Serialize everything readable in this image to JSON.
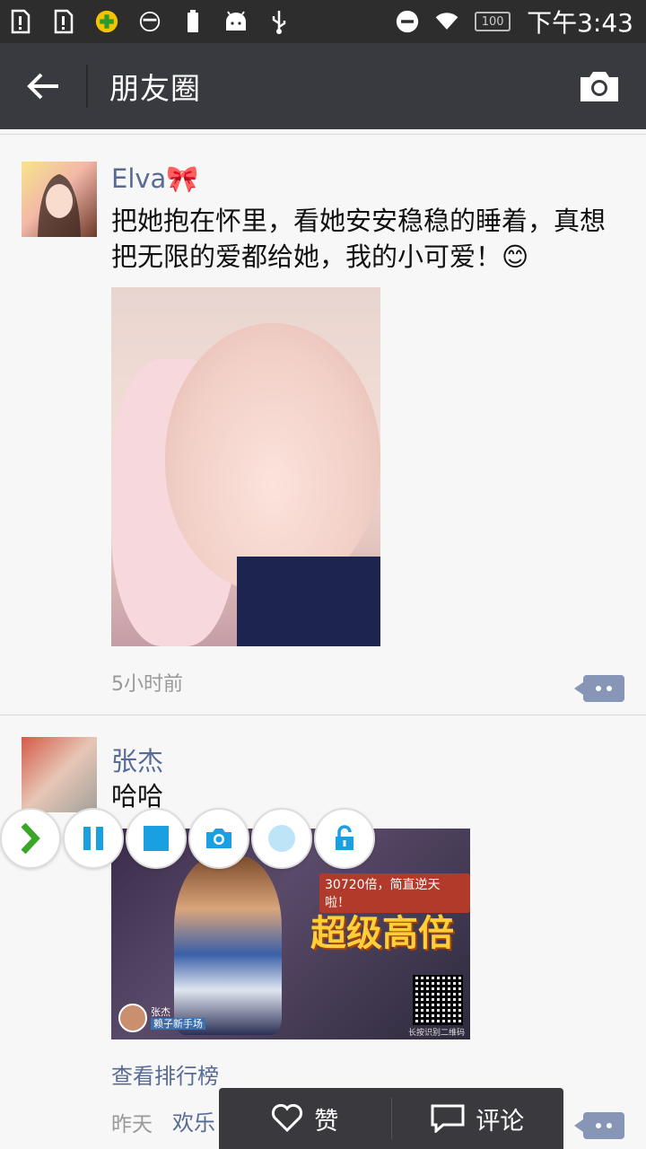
{
  "status_bar": {
    "time": "下午3:43",
    "battery": "100"
  },
  "app_bar": {
    "title": "朋友圈"
  },
  "posts": [
    {
      "name": "Elva🎀",
      "text": "把她抱在怀里，看她安安稳稳的睡着，真想把无限的爱都给她，我的小可爱！😊",
      "time": "5小时前"
    },
    {
      "name": "张杰",
      "text": "哈哈",
      "image": {
        "headline": "超级高倍",
        "tagline": "30720倍，简直逆天啦！",
        "badge_name": "张杰",
        "badge_sub": "赖子新手场",
        "qr_caption": "长按识别二维码"
      },
      "link": "查看排行榜",
      "time": "昨天",
      "source": "欢乐"
    }
  ],
  "floating_toolbar": {
    "items": [
      "expand",
      "pause",
      "stop",
      "screenshot",
      "record",
      "unlock"
    ]
  },
  "action_popup": {
    "like_label": "赞",
    "comment_label": "评论"
  },
  "colors": {
    "appbar": "#393a3f",
    "link": "#576b95",
    "accent_toolbar": "#1aa0e0"
  }
}
